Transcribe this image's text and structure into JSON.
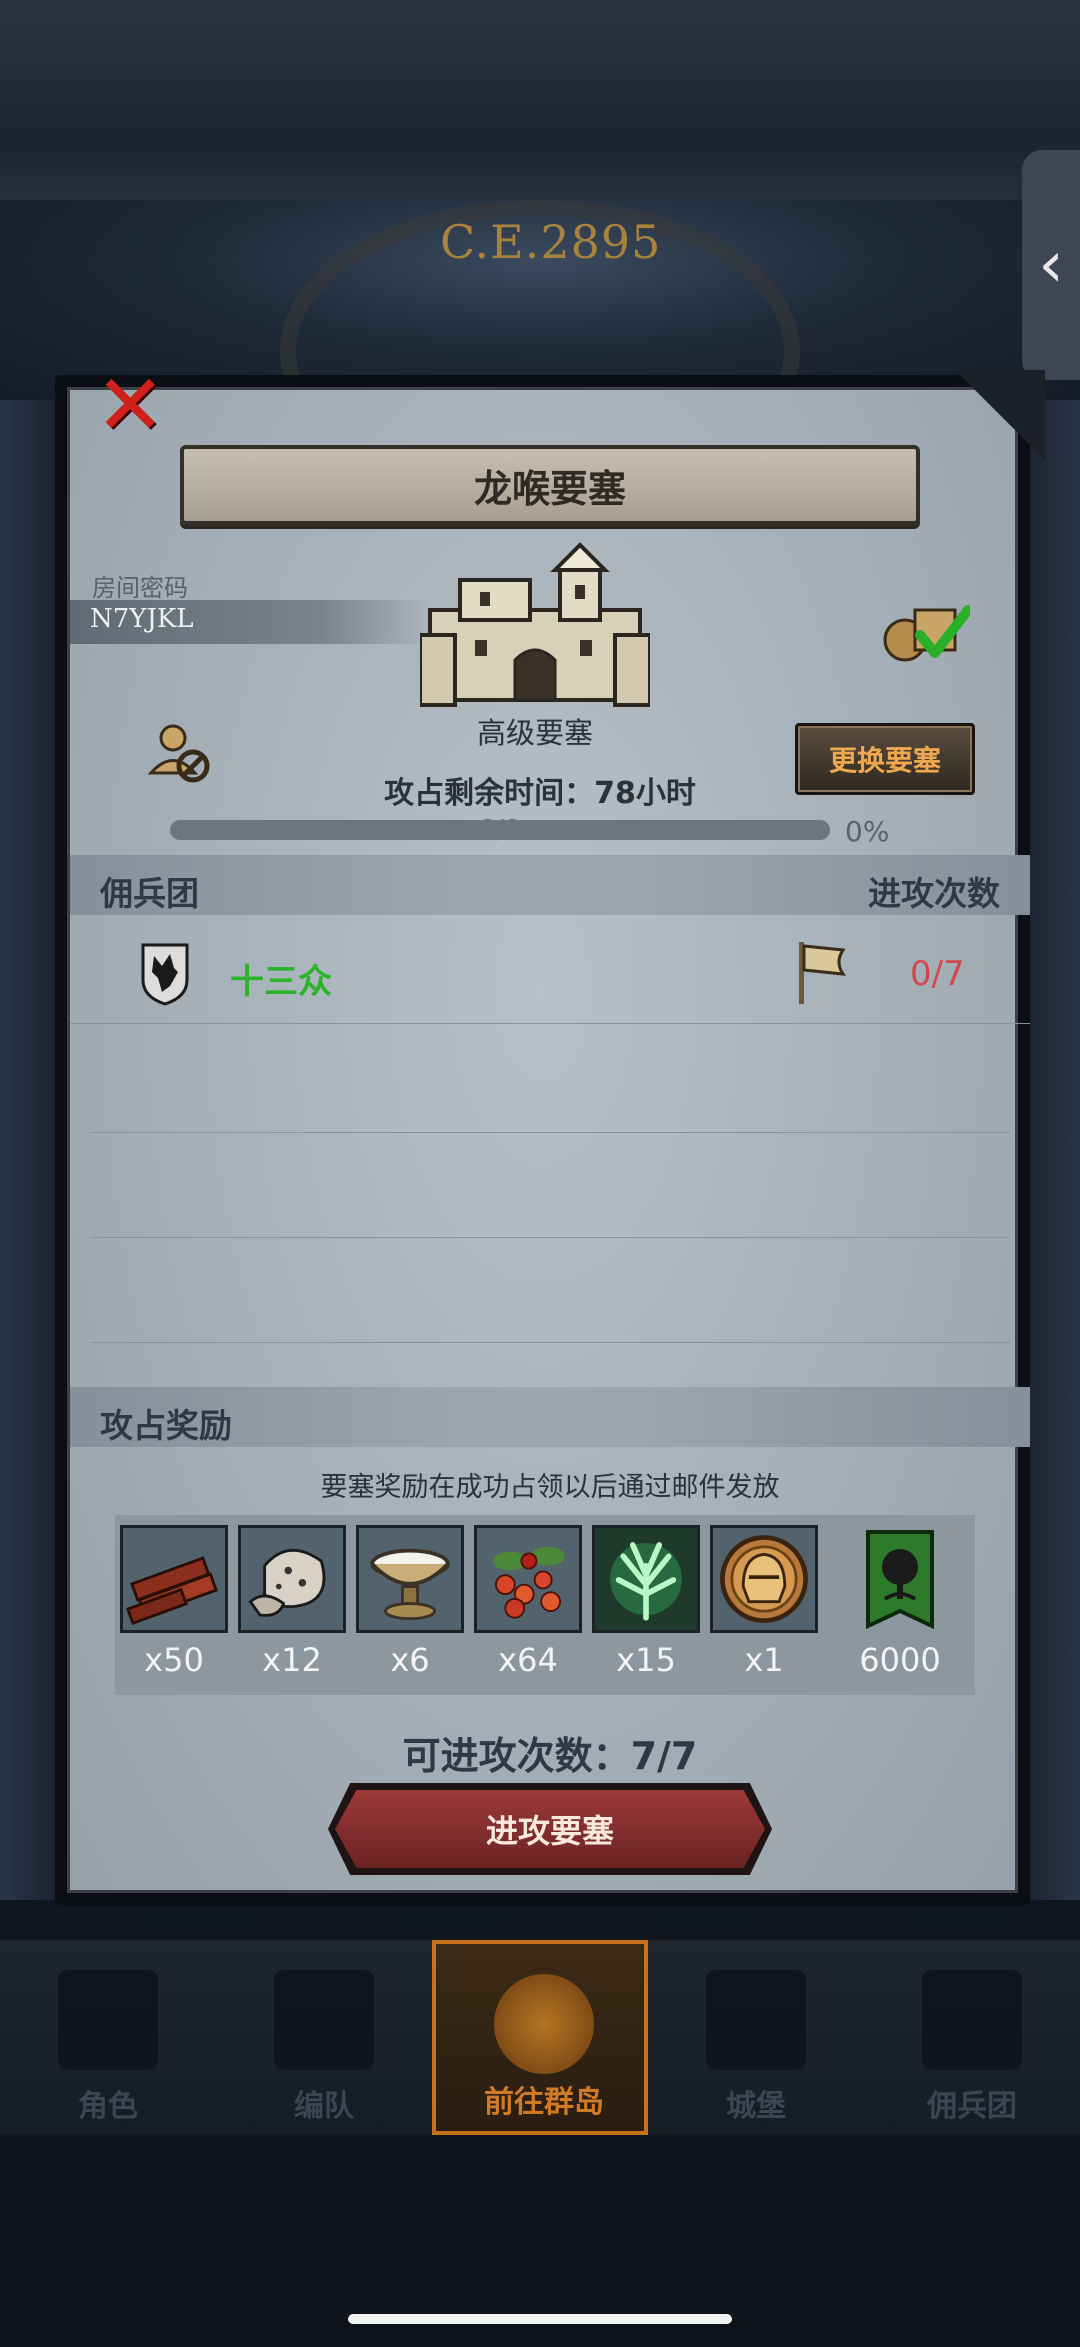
{
  "background": {
    "year": "C.E.2895",
    "side_tab_icon": "chevron-left-icon"
  },
  "modal": {
    "title": "龙喉要塞",
    "room_label": "房间密码",
    "room_code": "N7YJKL",
    "fortress_level": "高级要塞",
    "change_button": "更换要塞",
    "time_left": "攻占剩余时间：78小时",
    "progress": {
      "text": "0/0",
      "percent_label": "0%",
      "fraction": 0
    },
    "mercenary_header": "佣兵团",
    "attack_count_header": "进攻次数",
    "mercenaries": [
      {
        "name": "十三众",
        "attacks": "0/7"
      }
    ],
    "reward_header": "攻占奖励",
    "reward_note": "要塞奖励在成功占领以后通过邮件发放",
    "rewards": [
      {
        "icon": "wood-icon",
        "count": "x50"
      },
      {
        "icon": "ore-icon",
        "count": "x12"
      },
      {
        "icon": "bowl-icon",
        "count": "x6"
      },
      {
        "icon": "berries-icon",
        "count": "x64"
      },
      {
        "icon": "herb-icon",
        "count": "x15"
      },
      {
        "icon": "helmet-medal-icon",
        "count": "x1"
      },
      {
        "icon": "tree-banner-icon",
        "count": "6000"
      }
    ],
    "attacks_left": "可进攻次数：7/7",
    "attack_button": "进攻要塞"
  },
  "bottom_nav": [
    {
      "label": "角色",
      "icon": "knight-icon",
      "active": false
    },
    {
      "label": "编队",
      "icon": "team-icon",
      "active": false
    },
    {
      "label": "前往群岛",
      "icon": "map-icon",
      "active": true
    },
    {
      "label": "城堡",
      "icon": "castle-icon",
      "active": false
    },
    {
      "label": "佣兵团",
      "icon": "ship-icon",
      "active": false
    }
  ],
  "colors": {
    "accent_orange": "#d07a26",
    "merc_green": "#2bb32a",
    "attack_red": "#d2484b",
    "close_red": "#d0201c"
  }
}
